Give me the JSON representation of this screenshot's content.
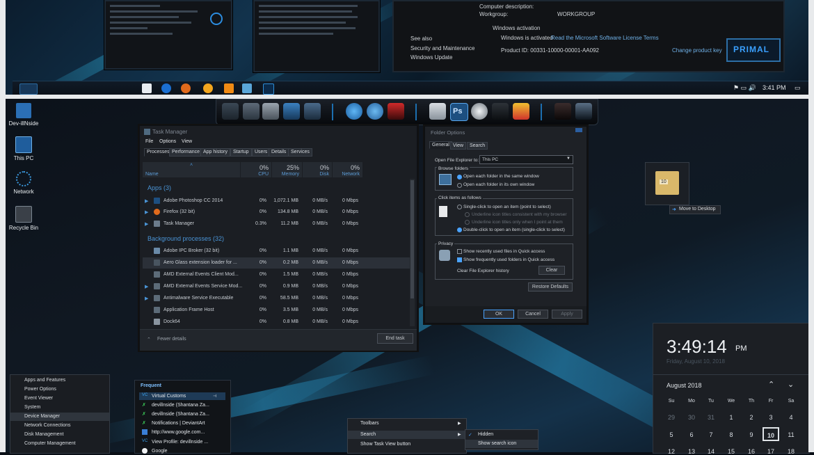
{
  "top_preview": {
    "system_info": {
      "computer_description_label": "Computer description:",
      "workgroup_label": "Workgroup:",
      "workgroup_value": "WORKGROUP",
      "activation_header": "Windows activation",
      "activation_status": "Windows is activated",
      "license_link": "Read the Microsoft Software License Terms",
      "product_id": "Product ID: 00331-10000-00001-AA092",
      "change_key_link": "Change product key",
      "see_also": "See also",
      "link_security": "Security and Maintenance",
      "link_update": "Windows Update",
      "logo_text": "PRIMAL"
    },
    "taskbar": {
      "time": "3:41 PM"
    }
  },
  "desktop_icons": [
    {
      "label": "Dev-illNside"
    },
    {
      "label": "This PC"
    },
    {
      "label": "Network"
    },
    {
      "label": "Recycle Bin"
    }
  ],
  "task_manager": {
    "title": "Task Manager",
    "menu": [
      "File",
      "Options",
      "View"
    ],
    "tabs": [
      "Processes",
      "Performance",
      "App history",
      "Startup",
      "Users",
      "Details",
      "Services"
    ],
    "columns": [
      {
        "pct": "",
        "name": "Name"
      },
      {
        "pct": "0%",
        "name": "CPU"
      },
      {
        "pct": "25%",
        "name": "Memory"
      },
      {
        "pct": "0%",
        "name": "Disk"
      },
      {
        "pct": "0%",
        "name": "Network"
      }
    ],
    "apps_header": "Apps (3)",
    "bg_header": "Background processes (32)",
    "apps": [
      {
        "name": "Adobe Photoshop CC 2014",
        "cpu": "0%",
        "mem": "1,072.1 MB",
        "disk": "0 MB/s",
        "net": "0 Mbps"
      },
      {
        "name": "Firefox (32 bit)",
        "cpu": "0%",
        "mem": "134.8 MB",
        "disk": "0 MB/s",
        "net": "0 Mbps"
      },
      {
        "name": "Task Manager",
        "cpu": "0.3%",
        "mem": "11.2 MB",
        "disk": "0 MB/s",
        "net": "0 Mbps"
      }
    ],
    "background": [
      {
        "name": "Adobe IPC Broker (32 bit)",
        "cpu": "0%",
        "mem": "1.1 MB",
        "disk": "0 MB/s",
        "net": "0 Mbps"
      },
      {
        "name": "Aero Glass extension loader for ...",
        "cpu": "0%",
        "mem": "0.2 MB",
        "disk": "0 MB/s",
        "net": "0 Mbps"
      },
      {
        "name": "AMD External Events Client Mod...",
        "cpu": "0%",
        "mem": "1.5 MB",
        "disk": "0 MB/s",
        "net": "0 Mbps"
      },
      {
        "name": "AMD External Events Service Mod...",
        "cpu": "0%",
        "mem": "0.9 MB",
        "disk": "0 MB/s",
        "net": "0 Mbps"
      },
      {
        "name": "Antimalware Service Executable",
        "cpu": "0%",
        "mem": "58.5 MB",
        "disk": "0 MB/s",
        "net": "0 Mbps"
      },
      {
        "name": "Application Frame Host",
        "cpu": "0%",
        "mem": "3.5 MB",
        "disk": "0 MB/s",
        "net": "0 Mbps"
      },
      {
        "name": "Dock64",
        "cpu": "0%",
        "mem": "0.8 MB",
        "disk": "0 MB/s",
        "net": "0 Mbps"
      }
    ],
    "fewer_details": "Fewer details",
    "end_task": "End task"
  },
  "folder_options": {
    "title": "Folder Options",
    "tabs": [
      "General",
      "View",
      "Search"
    ],
    "open_label": "Open File Explorer to:",
    "open_value": "This PC",
    "browse_header": "Browse folders",
    "browse_same": "Open each folder in the same window",
    "browse_own": "Open each folder in its own window",
    "click_header": "Click items as follows",
    "single_click": "Single-click to open an item (point to select)",
    "underline_browser": "Underline icon titles consistent with my browser",
    "underline_point": "Underline icon titles only when I point at them",
    "double_click": "Double-click to open an item (single-click to select)",
    "privacy_header": "Privacy",
    "recent_files": "Show recently used files in Quick access",
    "frequent_folders": "Show frequently used folders in Quick access",
    "clear_history": "Clear File Explorer history",
    "clear_btn": "Clear",
    "restore_btn": "Restore Defaults",
    "ok": "OK",
    "cancel": "Cancel",
    "apply": "Apply"
  },
  "drag_tip": {
    "text": "Move to Desktop",
    "badge": "10"
  },
  "clock": {
    "time": "3:49:14",
    "ampm": "PM",
    "date": "Friday, August 10, 2018",
    "month": "August 2018",
    "weekdays": [
      "Su",
      "Mo",
      "Tu",
      "We",
      "Th",
      "Fr",
      "Sa"
    ],
    "week1": [
      "29",
      "30",
      "31",
      "1",
      "2",
      "3",
      "4"
    ],
    "week2": [
      "5",
      "6",
      "7",
      "8",
      "9",
      "10",
      "11"
    ],
    "week3": [
      "12",
      "13",
      "14",
      "15",
      "16",
      "17",
      "18"
    ],
    "today": "10"
  },
  "winx_menu": {
    "items": [
      "Apps and Features",
      "Power Options",
      "Event Viewer",
      "System",
      "Device Manager",
      "Network Connections",
      "Disk Management",
      "Computer Management"
    ]
  },
  "jump_list": {
    "header": "Frequent",
    "items": [
      "Virtual Customs",
      "devillnside (Shantana Za...",
      "devillnside (Shantana Za...",
      "Notifications | DeviantArt",
      "http://www.google.com...",
      "View Profile: devillnside ...",
      "Google"
    ]
  },
  "context_menu": {
    "items": [
      "Toolbars",
      "Search",
      "Show Task View button"
    ]
  },
  "submenu": {
    "items": [
      "Hidden",
      "Show search icon"
    ]
  },
  "colors": {
    "accent": "#4a94d6",
    "link": "#6fb0e6",
    "background": "#0a0f16"
  }
}
